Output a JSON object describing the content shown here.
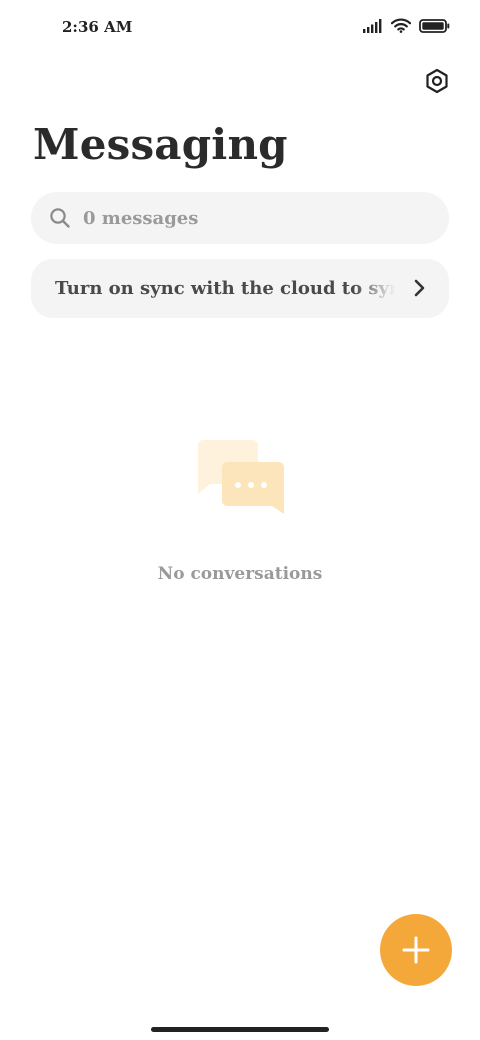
{
  "status_bar": {
    "time": "2:36 AM",
    "icons": [
      "signal-icon",
      "wifi-icon",
      "battery-icon"
    ]
  },
  "header": {
    "settings_icon": "gear-icon",
    "title": "Messaging"
  },
  "search": {
    "placeholder": "0 messages",
    "icon": "search-icon"
  },
  "sync_banner": {
    "text": "Turn on sync with the cloud to sync messages",
    "icon": "chevron-right-icon"
  },
  "empty_state": {
    "icon": "chat-bubbles-icon",
    "text": "No conversations"
  },
  "fab": {
    "icon": "plus-icon",
    "color": "#f5a83a"
  },
  "colors": {
    "accent": "#f5a83a",
    "surface": "#f4f4f4",
    "title": "#2b2b2b",
    "muted": "#9a9a9a"
  }
}
